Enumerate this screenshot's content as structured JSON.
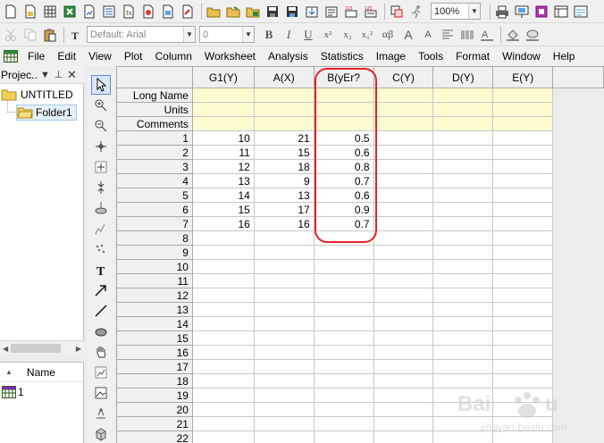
{
  "toolbar": {
    "font_name": "Default: Arial",
    "font_size": "0",
    "zoom": "100%",
    "format_buttons": [
      "B",
      "I",
      "U",
      "x²",
      "x₂",
      "x₁²",
      "αβ",
      "A",
      "A"
    ]
  },
  "menu": [
    "File",
    "Edit",
    "View",
    "Plot",
    "Column",
    "Worksheet",
    "Analysis",
    "Statistics",
    "Image",
    "Tools",
    "Format",
    "Window",
    "Help"
  ],
  "project": {
    "title": "Projec...",
    "root": "UNTITLED",
    "folder": "Folder1",
    "list_header": "Name",
    "list_item": "1"
  },
  "sheet": {
    "columns": [
      "G1(Y)",
      "A(X)",
      "B(yEr?",
      "C(Y)",
      "D(Y)",
      "E(Y)"
    ],
    "meta_rows": [
      "Long Name",
      "Units",
      "Comments"
    ],
    "rows": [
      {
        "n": "1",
        "g1": "10",
        "a": "21",
        "b": "0.5"
      },
      {
        "n": "2",
        "g1": "11",
        "a": "15",
        "b": "0.6"
      },
      {
        "n": "3",
        "g1": "12",
        "a": "18",
        "b": "0.8"
      },
      {
        "n": "4",
        "g1": "13",
        "a": "9",
        "b": "0.7"
      },
      {
        "n": "5",
        "g1": "14",
        "a": "13",
        "b": "0.6"
      },
      {
        "n": "6",
        "g1": "15",
        "a": "17",
        "b": "0.9"
      },
      {
        "n": "7",
        "g1": "16",
        "a": "16",
        "b": "0.7"
      },
      {
        "n": "8",
        "g1": "",
        "a": "",
        "b": ""
      },
      {
        "n": "9",
        "g1": "",
        "a": "",
        "b": ""
      },
      {
        "n": "10",
        "g1": "",
        "a": "",
        "b": ""
      },
      {
        "n": "11",
        "g1": "",
        "a": "",
        "b": ""
      },
      {
        "n": "12",
        "g1": "",
        "a": "",
        "b": ""
      },
      {
        "n": "13",
        "g1": "",
        "a": "",
        "b": ""
      },
      {
        "n": "14",
        "g1": "",
        "a": "",
        "b": ""
      },
      {
        "n": "15",
        "g1": "",
        "a": "",
        "b": ""
      },
      {
        "n": "16",
        "g1": "",
        "a": "",
        "b": ""
      },
      {
        "n": "17",
        "g1": "",
        "a": "",
        "b": ""
      },
      {
        "n": "18",
        "g1": "",
        "a": "",
        "b": ""
      },
      {
        "n": "19",
        "g1": "",
        "a": "",
        "b": ""
      },
      {
        "n": "20",
        "g1": "",
        "a": "",
        "b": ""
      },
      {
        "n": "21",
        "g1": "",
        "a": "",
        "b": ""
      },
      {
        "n": "22",
        "g1": "",
        "a": "",
        "b": ""
      }
    ]
  },
  "colors": {
    "highlight": "#e6232a",
    "meta_row_bg": "#fdfbd0"
  }
}
